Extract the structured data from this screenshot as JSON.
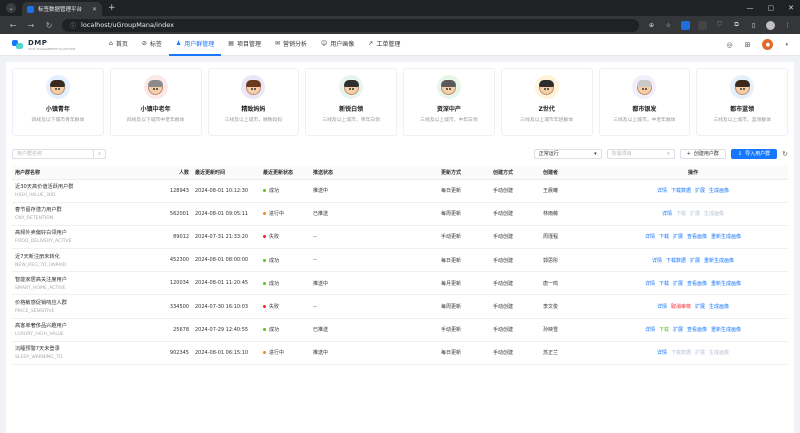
{
  "browser": {
    "tab_title": "标签数据管理平台",
    "url": "localhost/uGroupMana/index"
  },
  "app": {
    "logo": "DMP",
    "logo_sub": "DATA MANAGEMENT PLATFORM",
    "nav": [
      {
        "label": "首页",
        "icon": "home-icon"
      },
      {
        "label": "标签",
        "icon": "tag-icon"
      },
      {
        "label": "用户群管理",
        "icon": "users-icon"
      },
      {
        "label": "项目管理",
        "icon": "project-icon"
      },
      {
        "label": "营销分析",
        "icon": "analysis-icon"
      },
      {
        "label": "用户画像",
        "icon": "portrait-icon"
      },
      {
        "label": "工单管理",
        "icon": "ticket-icon"
      }
    ],
    "active_nav": "用户群管理"
  },
  "personas": [
    {
      "name": "小镇青年",
      "desc": "四线及以下城市青年群体",
      "hair": "#3a2a1e",
      "ring": "#e3f0ff"
    },
    {
      "name": "小镇中老年",
      "desc": "四线及以下城市中老年群体",
      "hair": "#8a8a8a",
      "ring": "#fde8e8"
    },
    {
      "name": "精致妈妈",
      "desc": "三线及以上城市，精致妈妈",
      "hair": "#6b3a23",
      "ring": "#eae6f8"
    },
    {
      "name": "新锐白领",
      "desc": "三线及以上城市，青年白领",
      "hair": "#2f2f2f",
      "ring": "#e8f4ee"
    },
    {
      "name": "资深中产",
      "desc": "三线及以上城市，中年白领",
      "hair": "#5a5a5a",
      "ring": "#e7f6e9"
    },
    {
      "name": "Z世代",
      "desc": "三线及以上城市年轻群体",
      "hair": "#2c2c2c",
      "ring": "#fff4d9"
    },
    {
      "name": "都市银发",
      "desc": "三线及以上城市，中老年群体",
      "hair": "#c9c9c9",
      "ring": "#f3eefc"
    },
    {
      "name": "都市蓝领",
      "desc": "三线及以上城市，蓝领群体",
      "hair": "#3b2a1c",
      "ring": "#e6f0fb"
    }
  ],
  "toolbar": {
    "search_placeholder": "用户群名称",
    "filter_status": "正常运行",
    "filter_project_placeholder": "所属项目",
    "create_label": "创建用户群",
    "import_label": "导入用户群"
  },
  "columns": [
    "用户群名称",
    "人数",
    "最近更新时间",
    "最近更新状态",
    "推送状态",
    "更新方式",
    "创建方式",
    "创建者",
    "操作"
  ],
  "status_colors": {
    "成功": "#52c41a",
    "进行中": "#fa8c16",
    "失败": "#f5222d"
  },
  "rows": [
    {
      "name": "近30天高价值活跃用户群",
      "code": "HIGH_VALUE_30D",
      "count": "128943",
      "time": "2024-08-01 10:12:30",
      "status": "成功",
      "push": "推送中",
      "update": "每日更新",
      "create": "手动创建",
      "creator": "王晨曦",
      "ops": [
        {
          "t": "详情",
          "c": "on"
        },
        {
          "t": "下载数据",
          "c": "on"
        },
        {
          "t": "扩展",
          "c": "on"
        },
        {
          "t": "生成画像",
          "c": "on"
        }
      ]
    },
    {
      "name": "春节留存潜力用户群",
      "code": "CNY_RETENTION",
      "count": "562001",
      "time": "2024-08-01 09:05:11",
      "status": "进行中",
      "push": "已推送",
      "update": "每周更新",
      "create": "手动创建",
      "creator": "林雨薇",
      "ops": [
        {
          "t": "详情",
          "c": "on"
        },
        {
          "t": "下载",
          "c": "off"
        },
        {
          "t": "扩展",
          "c": "off"
        },
        {
          "t": "生成画像",
          "c": "off"
        }
      ]
    },
    {
      "name": "高频外卖偏好白领用户",
      "code": "FOOD_DELIVERY_ACTIVE",
      "count": "89012",
      "time": "2024-07-31 21:33:20",
      "status": "失败",
      "push": "--",
      "update": "手动更新",
      "create": "手动创建",
      "creator": "周瑾程",
      "ops": [
        {
          "t": "详情",
          "c": "on"
        },
        {
          "t": "下载",
          "c": "on"
        },
        {
          "t": "扩展",
          "c": "on"
        },
        {
          "t": "查看画像",
          "c": "on"
        },
        {
          "t": "重新生成画像",
          "c": "on"
        }
      ]
    },
    {
      "name": "近7天新注册未转化",
      "code": "NEW_REG_7D_UNPAID",
      "count": "452300",
      "time": "2024-08-01 08:00:00",
      "status": "成功",
      "push": "--",
      "update": "每日更新",
      "create": "手动创建",
      "creator": "郭思彤",
      "ops": [
        {
          "t": "详情",
          "c": "on"
        },
        {
          "t": "下载数据",
          "c": "on"
        },
        {
          "t": "扩展",
          "c": "on"
        },
        {
          "t": "重新生成画像",
          "c": "on"
        }
      ]
    },
    {
      "name": "智能家居高关注度用户",
      "code": "SMART_HOME_ACTIVE",
      "count": "120034",
      "time": "2024-08-01 11:20:45",
      "status": "成功",
      "push": "推送中",
      "update": "每月更新",
      "create": "手动创建",
      "creator": "唐一鸣",
      "ops": [
        {
          "t": "详情",
          "c": "on"
        },
        {
          "t": "下载",
          "c": "on"
        },
        {
          "t": "扩展",
          "c": "on"
        },
        {
          "t": "查看画像",
          "c": "on"
        },
        {
          "t": "重新生成画像",
          "c": "on"
        }
      ]
    },
    {
      "name": "价格敏感促销响应人群",
      "code": "PRICE_SENSITIVE",
      "count": "334500",
      "time": "2024-07-30 16:10:03",
      "status": "失败",
      "push": "--",
      "update": "每周更新",
      "create": "手动创建",
      "creator": "李文俊",
      "ops": [
        {
          "t": "详情",
          "c": "on"
        },
        {
          "t": "取消审核",
          "c": "red"
        },
        {
          "t": "扩展",
          "c": "on"
        },
        {
          "t": "生成画像",
          "c": "on"
        }
      ]
    },
    {
      "name": "高客单奢侈品兴趣用户",
      "code": "LUXURY_HIGH_VALUE",
      "count": "25678",
      "time": "2024-07-29 12:40:55",
      "status": "成功",
      "push": "已推送",
      "update": "手动更新",
      "create": "手动创建",
      "creator": "孙映雪",
      "ops": [
        {
          "t": "详情",
          "c": "on"
        },
        {
          "t": "下载",
          "c": "green"
        },
        {
          "t": "扩展",
          "c": "on"
        },
        {
          "t": "查看画像",
          "c": "on"
        },
        {
          "t": "重新生成画像",
          "c": "on"
        }
      ]
    },
    {
      "name": "沉睡预警7天未登录",
      "code": "SLEEP_WARNING_7D",
      "count": "902345",
      "time": "2024-08-01 06:15:10",
      "status": "进行中",
      "push": "推送中",
      "update": "每日更新",
      "create": "手动创建",
      "creator": "苏正兰",
      "ops": [
        {
          "t": "详情",
          "c": "on"
        },
        {
          "t": "下载数据",
          "c": "off"
        },
        {
          "t": "扩展",
          "c": "off"
        },
        {
          "t": "生成画像",
          "c": "off"
        }
      ]
    }
  ]
}
